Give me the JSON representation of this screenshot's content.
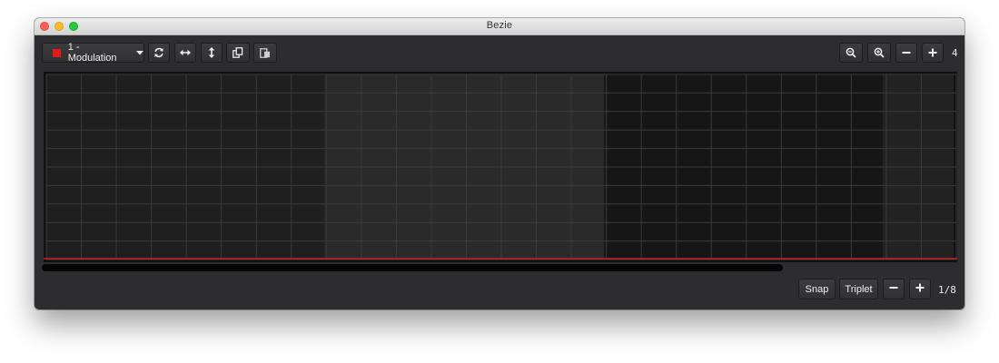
{
  "window": {
    "title": "Bezie"
  },
  "toolbar": {
    "parameter": {
      "label": "1 - Modulation",
      "color": "#e51a17"
    },
    "tools": [
      {
        "name": "refresh-icon"
      },
      {
        "name": "horizontal-arrows-icon"
      },
      {
        "name": "vertical-arrows-icon"
      },
      {
        "name": "copy-icon"
      },
      {
        "name": "paste-icon"
      }
    ],
    "zoom": [
      {
        "name": "zoom-out-icon"
      },
      {
        "name": "zoom-in-icon"
      },
      {
        "name": "minus-icon"
      },
      {
        "name": "plus-icon"
      }
    ],
    "bars_value": "4"
  },
  "editor": {
    "curve_color": "#c2221f",
    "curve_level": 0,
    "scroll_fraction": 0.81
  },
  "footer": {
    "snap_label": "Snap",
    "triplet_label": "Triplet",
    "minus_icon": "minus-icon",
    "plus_icon": "plus-icon",
    "grid_value": "1/8"
  }
}
